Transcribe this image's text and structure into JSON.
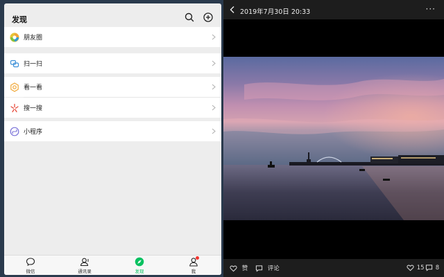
{
  "discover": {
    "title": "发现",
    "menu": [
      {
        "label": "朋友圈",
        "icon": "moments-icon"
      },
      {
        "label": "扫一扫",
        "icon": "scan-icon"
      },
      {
        "label": "看一看",
        "icon": "top-stories-icon"
      },
      {
        "label": "搜一搜",
        "icon": "search-star-icon"
      },
      {
        "label": "小程序",
        "icon": "mini-programs-icon"
      }
    ]
  },
  "tabbar": [
    {
      "label": "微信",
      "icon": "chat-icon"
    },
    {
      "label": "通讯录",
      "icon": "contacts-icon"
    },
    {
      "label": "发现",
      "icon": "discover-icon",
      "active": true
    },
    {
      "label": "我",
      "icon": "me-icon",
      "badge": true
    }
  ],
  "post": {
    "timestamp": "2019年7月30日 20:33",
    "like_label": "赞",
    "comment_label": "评论",
    "likes_count": "15",
    "comments_count": "8"
  },
  "colors": {
    "accent": "#07c160",
    "badge": "#f43530"
  }
}
